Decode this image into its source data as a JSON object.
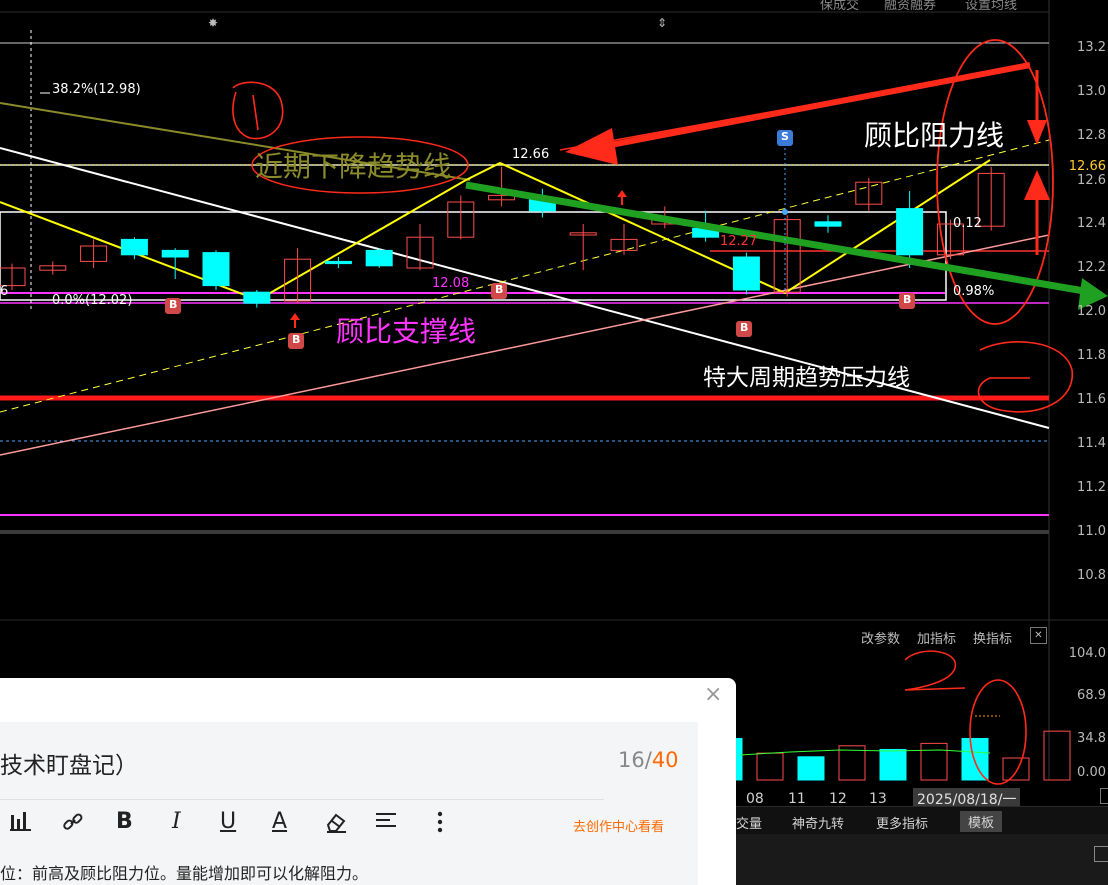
{
  "top_menu": [
    "保成交",
    "融资融券",
    "设置均线"
  ],
  "price_axis": [
    "13.2",
    "13.0",
    "12.8",
    "12.66",
    "12.6",
    "12.4",
    "12.2",
    "12.0",
    "11.8",
    "11.6",
    "11.4",
    "11.2",
    "11.0",
    "10.8"
  ],
  "volume_axis": [
    "104.0",
    "68.9",
    "34.8",
    "0.00"
  ],
  "volume_toolbar": {
    "modify_params": "改参数",
    "add_indicator": "加指标",
    "switch_indicator": "换指标",
    "close": "✕"
  },
  "dates": [
    "08",
    "11",
    "12",
    "13",
    "2025/08/18/一"
  ],
  "bottom_tabs": {
    "volume": "交量",
    "magic_nine": "神奇九转",
    "more": "更多指标",
    "template": "模板"
  },
  "chart_labels": {
    "fib_382": "38.2%(12.98)",
    "fib_0": "0.0%(12.02)",
    "left_cut": "6",
    "high_label": "12.66",
    "label_1227": "12.27",
    "label_1208": "12.08",
    "box_top": "0.12",
    "box_bottom": "0.98%",
    "marker_s": "S",
    "marker_b": "B"
  },
  "annotations": {
    "resistance": "顾比阻力线",
    "downtrend": "近期下降趋势线",
    "support": "顾比支撑线",
    "long_trend": "特大周期趋势压力线"
  },
  "editor": {
    "close": "×",
    "title": "技术盯盘记）",
    "count_current": "16",
    "count_sep": "/",
    "count_max": "40",
    "creator_link": "去创作中心看看",
    "body": "位：前高及顾比阻力位。量能增加即可以化解阻力。"
  },
  "colors": {
    "up": "#ff4d4d",
    "down": "#00ffff",
    "yellow": "#ffff00",
    "magenta": "#ff33ff",
    "red_annot": "#ff2a1a",
    "green_arrow": "#20a020",
    "olive": "#8a8a2a"
  },
  "chart_data": {
    "type": "candlestick",
    "candles": [
      {
        "open": 12.12,
        "close": 12.2,
        "high": 12.22,
        "low": 12.1
      },
      {
        "open": 12.19,
        "close": 12.21,
        "high": 12.23,
        "low": 12.17
      },
      {
        "open": 12.23,
        "close": 12.3,
        "high": 12.33,
        "low": 12.2
      },
      {
        "open": 12.33,
        "close": 12.26,
        "high": 12.34,
        "low": 12.24
      },
      {
        "open": 12.28,
        "close": 12.25,
        "high": 12.29,
        "low": 12.15
      },
      {
        "open": 12.27,
        "close": 12.12,
        "high": 12.28,
        "low": 12.1
      },
      {
        "open": 12.09,
        "close": 12.04,
        "high": 12.1,
        "low": 12.02
      },
      {
        "open": 12.05,
        "close": 12.24,
        "high": 12.29,
        "low": 12.04
      },
      {
        "open": 12.23,
        "close": 12.22,
        "high": 12.25,
        "low": 12.2
      },
      {
        "open": 12.28,
        "close": 12.21,
        "high": 12.29,
        "low": 12.2
      },
      {
        "open": 12.2,
        "close": 12.34,
        "high": 12.4,
        "low": 12.19
      },
      {
        "open": 12.34,
        "close": 12.5,
        "high": 12.53,
        "low": 12.33
      },
      {
        "open": 12.51,
        "close": 12.53,
        "high": 12.66,
        "low": 12.48
      },
      {
        "open": 12.52,
        "close": 12.46,
        "high": 12.56,
        "low": 12.43
      },
      {
        "open": 12.35,
        "close": 12.36,
        "high": 12.4,
        "low": 12.19
      },
      {
        "open": 12.28,
        "close": 12.33,
        "high": 12.4,
        "low": 12.26
      },
      {
        "open": 12.4,
        "close": 12.42,
        "high": 12.48,
        "low": 12.38
      },
      {
        "open": 12.38,
        "close": 12.34,
        "high": 12.46,
        "low": 12.32
      },
      {
        "open": 12.25,
        "close": 12.1,
        "high": 12.27,
        "low": 12.08
      },
      {
        "open": 12.09,
        "close": 12.42,
        "high": 12.44,
        "low": 12.07
      },
      {
        "open": 12.41,
        "close": 12.39,
        "high": 12.44,
        "low": 12.36
      },
      {
        "open": 12.49,
        "close": 12.59,
        "high": 12.61,
        "low": 12.46
      },
      {
        "open": 12.47,
        "close": 12.26,
        "high": 12.55,
        "low": 12.2
      },
      {
        "open": 12.26,
        "close": 12.4,
        "high": 12.42,
        "low": 12.24
      },
      {
        "open": 12.39,
        "close": 12.63,
        "high": 12.66,
        "low": 12.37
      }
    ],
    "volume": [
      34,
      22,
      19,
      28,
      25,
      30,
      34,
      18,
      40
    ],
    "ylim": [
      10.8,
      13.2
    ],
    "volume_ylim": [
      0,
      104
    ]
  }
}
